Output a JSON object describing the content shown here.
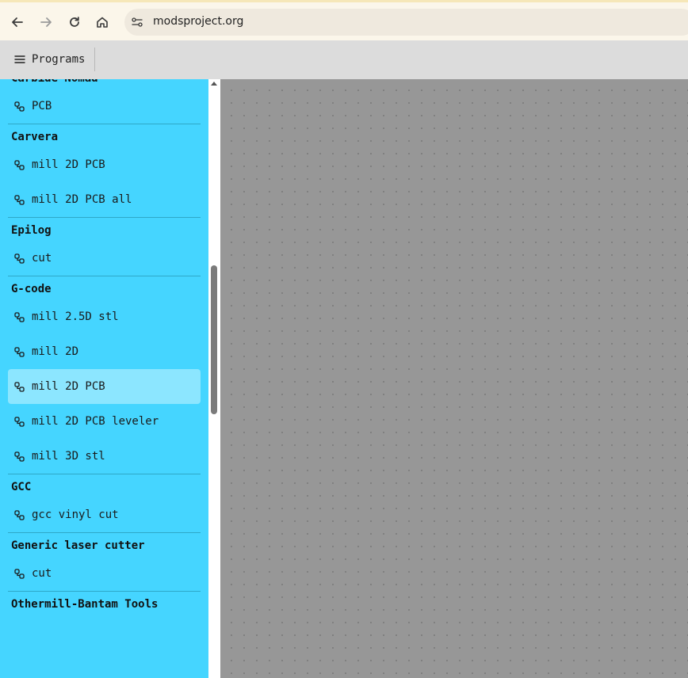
{
  "browser": {
    "url": "modsproject.org"
  },
  "toolbar": {
    "programs_label": "Programs"
  },
  "sidebar": {
    "sections": [
      {
        "title": "Carbide Nomad",
        "items": [
          "PCB"
        ]
      },
      {
        "title": "Carvera",
        "items": [
          "mill 2D PCB",
          "mill 2D PCB all"
        ]
      },
      {
        "title": "Epilog",
        "items": [
          "cut"
        ]
      },
      {
        "title": "G-code",
        "items": [
          "mill 2.5D stl",
          "mill 2D",
          "mill 2D PCB",
          "mill 2D PCB leveler",
          "mill 3D stl"
        ]
      },
      {
        "title": "GCC",
        "items": [
          "gcc vinyl cut"
        ]
      },
      {
        "title": "Generic laser cutter",
        "items": [
          "cut"
        ]
      },
      {
        "title": "Othermill-Bantam Tools",
        "items": []
      }
    ],
    "selected": {
      "section": 3,
      "item": 2
    }
  },
  "colors": {
    "sidebar_bg": "#45d5ff",
    "selected_bg": "#8ce6ff",
    "canvas_bg": "#979797"
  }
}
